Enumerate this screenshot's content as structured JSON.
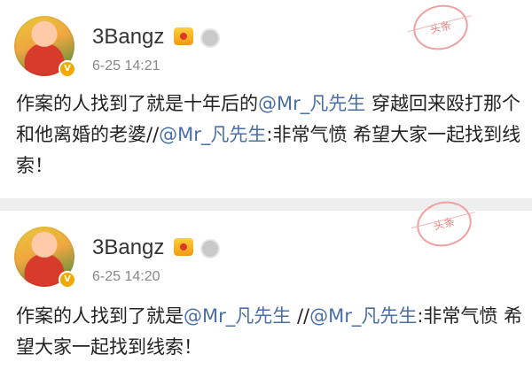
{
  "posts": [
    {
      "username": "3Bangz",
      "timestamp": "6-25 14:21",
      "verified_mark": "V",
      "stamp_text": "头条",
      "text_parts": [
        {
          "t": "作案的人找到了就是十年后的",
          "type": "text"
        },
        {
          "t": "@Mr_凡先生",
          "type": "mention"
        },
        {
          "t": " 穿越回来殴打那个和他离婚的老婆//",
          "type": "text"
        },
        {
          "t": "@Mr_凡先生",
          "type": "mention"
        },
        {
          "t": ":非常气愤 希望大家一起找到线索！",
          "type": "text"
        }
      ]
    },
    {
      "username": "3Bangz",
      "timestamp": "6-25 14:20",
      "verified_mark": "V",
      "stamp_text": "头条",
      "text_parts": [
        {
          "t": "作案的人找到了就是",
          "type": "text"
        },
        {
          "t": "@Mr_凡先生",
          "type": "mention"
        },
        {
          "t": " //",
          "type": "text"
        },
        {
          "t": "@Mr_凡先生",
          "type": "mention"
        },
        {
          "t": ":非常气愤 希望大家一起找到线索！",
          "type": "text"
        }
      ]
    }
  ],
  "icons": {
    "avatar": "avatar-image",
    "verified": "verified-badge-icon",
    "vip": "vip-crown-icon",
    "medal": "medal-icon",
    "stamp": "watermark-stamp"
  },
  "colors": {
    "mention": "#4a6fa5",
    "timestamp": "#888888",
    "separator": "#eeeeee"
  }
}
